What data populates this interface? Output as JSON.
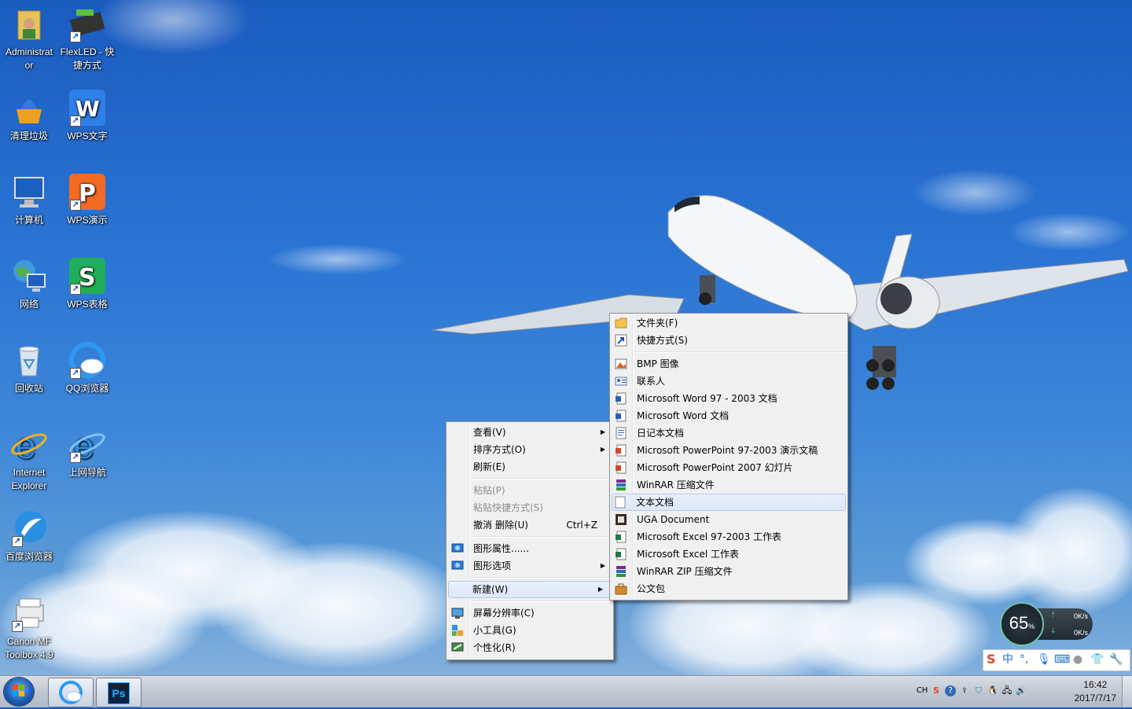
{
  "desktop": {
    "icons": [
      {
        "label": "Administrat or",
        "icon": "user-folder-icon"
      },
      {
        "label": "FlexLED - 快捷方式",
        "icon": "led-keyboard-icon"
      },
      {
        "label": "清理垃圾",
        "icon": "broom-icon"
      },
      {
        "label": "WPS文字",
        "icon": "wps-writer-icon"
      },
      {
        "label": "计算机",
        "icon": "computer-icon"
      },
      {
        "label": "WPS演示",
        "icon": "wps-presentation-icon"
      },
      {
        "label": "网络",
        "icon": "network-icon"
      },
      {
        "label": "WPS表格",
        "icon": "wps-spreadsheet-icon"
      },
      {
        "label": "回收站",
        "icon": "recycle-bin-icon"
      },
      {
        "label": "QQ浏览器",
        "icon": "qq-browser-icon"
      },
      {
        "label": "Internet Explorer",
        "icon": "ie-icon"
      },
      {
        "label": "上网导航",
        "icon": "ie-navigation-icon"
      },
      {
        "label": "百度浏览器",
        "icon": "baidu-browser-icon"
      },
      {
        "label": "Canon MF Toolbox 4.9",
        "icon": "printer-icon"
      }
    ]
  },
  "context_menu": {
    "items": {
      "view": "查看(V)",
      "sort": "排序方式(O)",
      "refresh": "刷新(E)",
      "paste": "粘贴(P)",
      "paste_shortcut": "粘贴快捷方式(S)",
      "undo_delete": "撤消 删除(U)",
      "undo_shortcut": "Ctrl+Z",
      "graphics_props": "图形属性......",
      "graphics_options": "图形选项",
      "new": "新建(W)",
      "screen_resolution": "屏幕分辨率(C)",
      "gadgets": "小工具(G)",
      "personalize": "个性化(R)"
    }
  },
  "new_submenu": {
    "items": {
      "folder": "文件夹(F)",
      "shortcut": "快捷方式(S)",
      "bmp": "BMP 图像",
      "contact": "联系人",
      "word97": "Microsoft Word 97 - 2003 文档",
      "word": "Microsoft Word 文档",
      "journal": "日记本文档",
      "ppt97": "Microsoft PowerPoint 97-2003 演示文稿",
      "ppt2007": "Microsoft PowerPoint 2007 幻灯片",
      "winrar": "WinRAR 压缩文件",
      "text": "文本文档",
      "uga": "UGA Document",
      "excel97": "Microsoft Excel 97-2003 工作表",
      "excel": "Microsoft Excel 工作表",
      "winrar_zip": "WinRAR ZIP 压缩文件",
      "briefcase": "公文包"
    }
  },
  "net_widget": {
    "percent": "65",
    "percent_unit": "%",
    "up_rate": "0K/s",
    "down_rate": "0K/s"
  },
  "ime": {
    "mode": "中"
  },
  "taskbar": {
    "lang": "CH",
    "time": "16:42",
    "date": "2017/7/17",
    "apps": [
      "qq-browser-icon",
      "photoshop-icon"
    ],
    "ps_label": "Ps"
  }
}
